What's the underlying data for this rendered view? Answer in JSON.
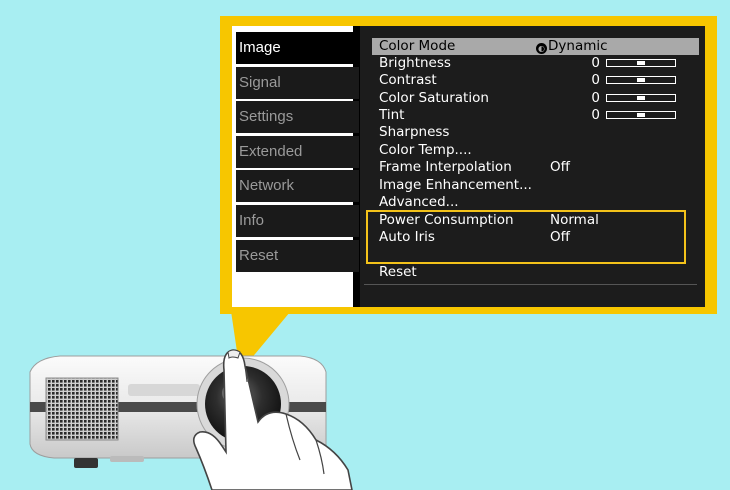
{
  "tabs": [
    {
      "label": "Image",
      "active": true
    },
    {
      "label": "Signal",
      "active": false
    },
    {
      "label": "Settings",
      "active": false
    },
    {
      "label": "Extended",
      "active": false
    },
    {
      "label": "Network",
      "active": false
    },
    {
      "label": "Info",
      "active": false
    },
    {
      "label": "Reset",
      "active": false
    }
  ],
  "menu": {
    "color_mode": {
      "label": "Color Mode",
      "value": "Dynamic",
      "icon": "dynamic-mode-icon"
    },
    "brightness": {
      "label": "Brightness",
      "value": "0"
    },
    "contrast": {
      "label": "Contrast",
      "value": "0"
    },
    "color_saturation": {
      "label": "Color Saturation",
      "value": "0"
    },
    "tint": {
      "label": "Tint",
      "value": "0"
    },
    "sharpness": {
      "label": "Sharpness"
    },
    "color_temp": {
      "label": "Color Temp...."
    },
    "frame_interpolation": {
      "label": "Frame Interpolation",
      "value": "Off"
    },
    "image_enhancement": {
      "label": "Image Enhancement..."
    },
    "advanced": {
      "label": "Advanced..."
    },
    "power_consumption": {
      "label": "Power Consumption",
      "value": "Normal"
    },
    "auto_iris": {
      "label": "Auto Iris",
      "value": "Off"
    },
    "reset": {
      "label": "Reset"
    }
  },
  "colors": {
    "background": "#a8eef2",
    "callout": "#f7c600",
    "highlight_border": "#f3c21a",
    "selected_row": "#a9a9a9"
  }
}
